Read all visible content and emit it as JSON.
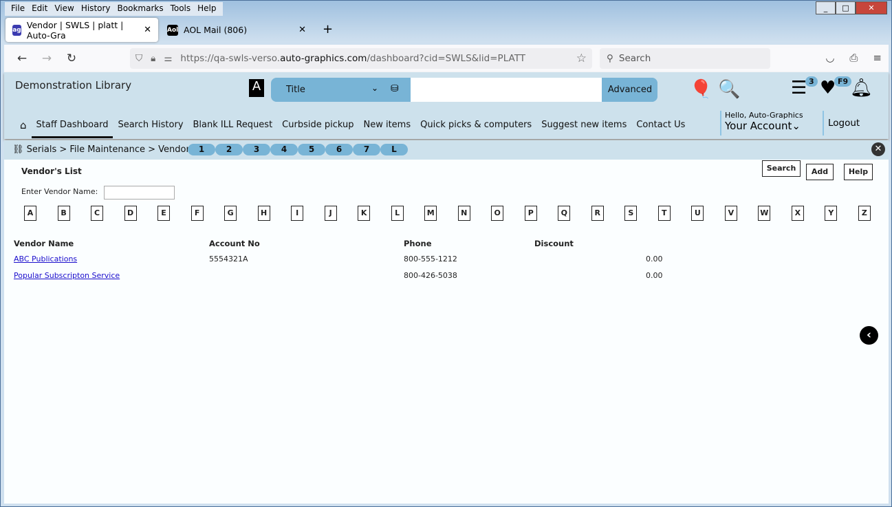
{
  "browser": {
    "menu": [
      "File",
      "Edit",
      "View",
      "History",
      "Bookmarks",
      "Tools",
      "Help"
    ],
    "tabs": [
      {
        "title": "Vendor | SWLS | platt | Auto-Gra"
      },
      {
        "title": "AOL Mail (806)"
      }
    ],
    "url_prefix": "https://qa-swls-verso.",
    "url_domain": "auto-graphics.com",
    "url_suffix": "/dashboard?cid=SWLS&lid=PLATT",
    "search_placeholder": "Search"
  },
  "header": {
    "library": "Demonstration Library",
    "search_type": "Title",
    "advanced": "Advanced",
    "list_badge": "3",
    "fav_badge": "F9",
    "nav": [
      "Staff Dashboard",
      "Search History",
      "Blank ILL Request",
      "Curbside pickup",
      "New items",
      "Quick picks & computers",
      "Suggest new items",
      "Contact Us"
    ],
    "hello": "Hello, Auto-Graphics",
    "account": "Your Account",
    "logout": "Logout"
  },
  "breadcrumb": {
    "text": "Serials > File Maintenance > Vendor",
    "pills": [
      "1",
      "2",
      "3",
      "4",
      "5",
      "6",
      "7",
      "L"
    ]
  },
  "main": {
    "title": "Vendor's List",
    "search": "Search",
    "add": "Add",
    "help": "Help",
    "vendor_label": "Enter Vendor Name:",
    "vendor_value": "",
    "letters": [
      "A",
      "B",
      "C",
      "D",
      "E",
      "F",
      "G",
      "H",
      "I",
      "J",
      "K",
      "L",
      "M",
      "N",
      "O",
      "P",
      "Q",
      "R",
      "S",
      "T",
      "U",
      "V",
      "W",
      "X",
      "Y",
      "Z"
    ],
    "columns": [
      "Vendor Name",
      "Account No",
      "Phone",
      "Discount"
    ],
    "rows": [
      {
        "name": "ABC Publications",
        "account": "5554321A",
        "phone": "800-555-1212",
        "discount": "0.00"
      },
      {
        "name": "Popular Subscripton Service",
        "account": "",
        "phone": "800-426-5038",
        "discount": "0.00"
      }
    ]
  }
}
